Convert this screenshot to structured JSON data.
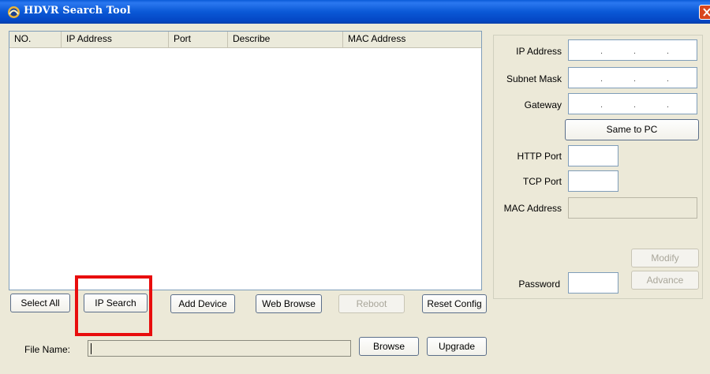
{
  "window": {
    "title": "HDVR Search Tool"
  },
  "list": {
    "columns": [
      "NO.",
      "IP Address",
      "Port",
      "Describe",
      "MAC Address"
    ]
  },
  "buttons": {
    "select_all": "Select All",
    "ip_search": "IP Search",
    "add_device": "Add Device",
    "web_browse": "Web Browse",
    "reboot": "Reboot",
    "reset_config": "Reset Config",
    "browse": "Browse",
    "upgrade": "Upgrade",
    "same_to_pc": "Same to PC",
    "modify": "Modify",
    "advance": "Advance"
  },
  "config": {
    "ip_address_label": "IP Address",
    "subnet_mask_label": "Subnet Mask",
    "gateway_label": "Gateway",
    "http_port_label": "HTTP Port",
    "tcp_port_label": "TCP Port",
    "mac_address_label": "MAC Address",
    "password_label": "Password"
  },
  "file": {
    "label": "File Name:"
  }
}
